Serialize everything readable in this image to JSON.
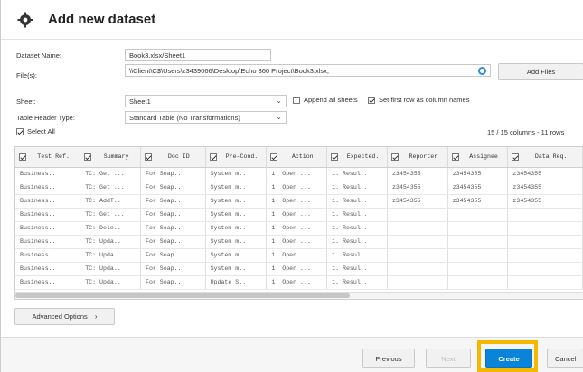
{
  "dialog": {
    "title": "Add new dataset"
  },
  "form": {
    "dataset_name_label": "Dataset Name:",
    "dataset_name_value": "Book3.xlsx/Sheet1",
    "files_label": "File(s):",
    "files_value": "\\\\Client\\C$\\Users\\z3439066\\Desktop\\Echo 360 Project\\Book3.xlsx;",
    "add_files_label": "Add Files",
    "sheet_label": "Sheet:",
    "sheet_value": "Sheet1",
    "append_all_sheets_label": "Append all sheets",
    "first_row_label": "Set first row as column names",
    "header_type_label": "Table Header Type:",
    "header_type_value": "Standard Table (No Transformations)",
    "select_all_label": "Select All",
    "summary": "15 / 15 columns - 11 rows"
  },
  "table": {
    "columns": [
      "Test Ref.",
      "Summary",
      "Doc ID",
      "Pre-Cond.",
      "Action",
      "Expected.",
      "Reporter",
      "Assignee",
      "Data Req."
    ],
    "rows": [
      [
        "Business..",
        "TC: Get ...",
        "For Soap..",
        "System m..",
        "1. Open ...",
        "1. Resul..",
        "z3454355",
        "z3454355",
        "z3454355"
      ],
      [
        "Business..",
        "TC: Get ...",
        "For Soap..",
        "System m..",
        "1. Open ...",
        "1. Resul..",
        "z3454355",
        "z3454355",
        "z3454355"
      ],
      [
        "Business..",
        "TC: AddT..",
        "For Soap..",
        "System m..",
        "1. Open ...",
        "1. Resul..",
        "z3454355",
        "z3454355",
        "z3454355"
      ],
      [
        "Business..",
        "TC: Get ...",
        "For Soap..",
        "System m..",
        "1. Open ...",
        "1. Resul..",
        "",
        "",
        ""
      ],
      [
        "Business..",
        "TC: Dele..",
        "For Soap..",
        "System m..",
        "1. Open ...",
        "1. Resul..",
        "",
        "",
        ""
      ],
      [
        "Business..",
        "TC: Upda..",
        "For Soap..",
        "System m..",
        "1. Open ...",
        "1. Resul..",
        "",
        "",
        ""
      ],
      [
        "Business..",
        "TC: Upda..",
        "For Soap..",
        "System m..",
        "1. Open ...",
        "1. Resul..",
        "",
        "",
        ""
      ],
      [
        "Business..",
        "TC: Upda..",
        "For Soap..",
        "System m..",
        "1. Open ...",
        "1. Resul..",
        "",
        "",
        ""
      ],
      [
        "Business..",
        "TC: Upda..",
        "For Soap..",
        "Update S..",
        "1. Open ...",
        "1. Resul..",
        "",
        "",
        ""
      ]
    ]
  },
  "advanced_options_label": "Advanced Options",
  "footer": {
    "previous_label": "Previous",
    "next_label": "Next",
    "create_label": "Create",
    "cancel_label": "Cancel"
  },
  "colors": {
    "accent": "#0a84d8",
    "highlight": "#f5b800"
  }
}
